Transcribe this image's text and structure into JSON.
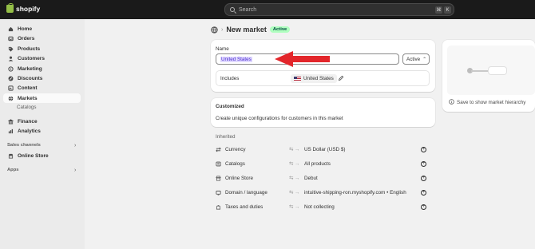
{
  "topbar": {
    "brand": "shopify",
    "search_placeholder": "Search",
    "shortcut_keys": [
      "⌘",
      "K"
    ]
  },
  "sidebar": {
    "items": [
      {
        "label": "Home",
        "icon": "home-icon"
      },
      {
        "label": "Orders",
        "icon": "orders-icon"
      },
      {
        "label": "Products",
        "icon": "tag-icon"
      },
      {
        "label": "Customers",
        "icon": "person-icon"
      },
      {
        "label": "Marketing",
        "icon": "target-icon"
      },
      {
        "label": "Discounts",
        "icon": "discount-icon"
      },
      {
        "label": "Content",
        "icon": "content-icon"
      },
      {
        "label": "Markets",
        "icon": "globe-icon"
      }
    ],
    "sub_item": "Catalogs",
    "items2": [
      {
        "label": "Finance",
        "icon": "bank-icon"
      },
      {
        "label": "Analytics",
        "icon": "chart-icon"
      }
    ],
    "sales_channels_title": "Sales channels",
    "online_store": "Online Store",
    "apps_title": "Apps"
  },
  "header": {
    "title": "New market",
    "badge": "Active"
  },
  "name_card": {
    "name_label": "Name",
    "name_value": "United States",
    "status_value": "Active",
    "includes_label": "Includes",
    "includes_chip": "United States"
  },
  "customized_card": {
    "title": "Customized",
    "description": "Create unique configurations for customers in this market"
  },
  "inherited": {
    "title": "Inherited",
    "rows": [
      {
        "name": "Currency",
        "value": "US Dollar (USD $)",
        "icon": "currency-icon"
      },
      {
        "name": "Catalogs",
        "value": "All products",
        "icon": "catalog-icon"
      },
      {
        "name": "Online Store",
        "value": "Debut",
        "icon": "store-icon"
      },
      {
        "name": "Domain / language",
        "value": "intuitive-shipping-ron.myshopify.com • English",
        "icon": "domain-icon"
      },
      {
        "name": "Taxes and duties",
        "value": "Not collecting",
        "icon": "tax-icon"
      }
    ]
  },
  "hierarchy": {
    "save_text": "Save to show market hierarchy"
  },
  "colors": {
    "topbar": "#1a1a1a",
    "badge_bg": "#affebf",
    "arrow": "#e3262b",
    "selection": "#e0d9ff"
  }
}
